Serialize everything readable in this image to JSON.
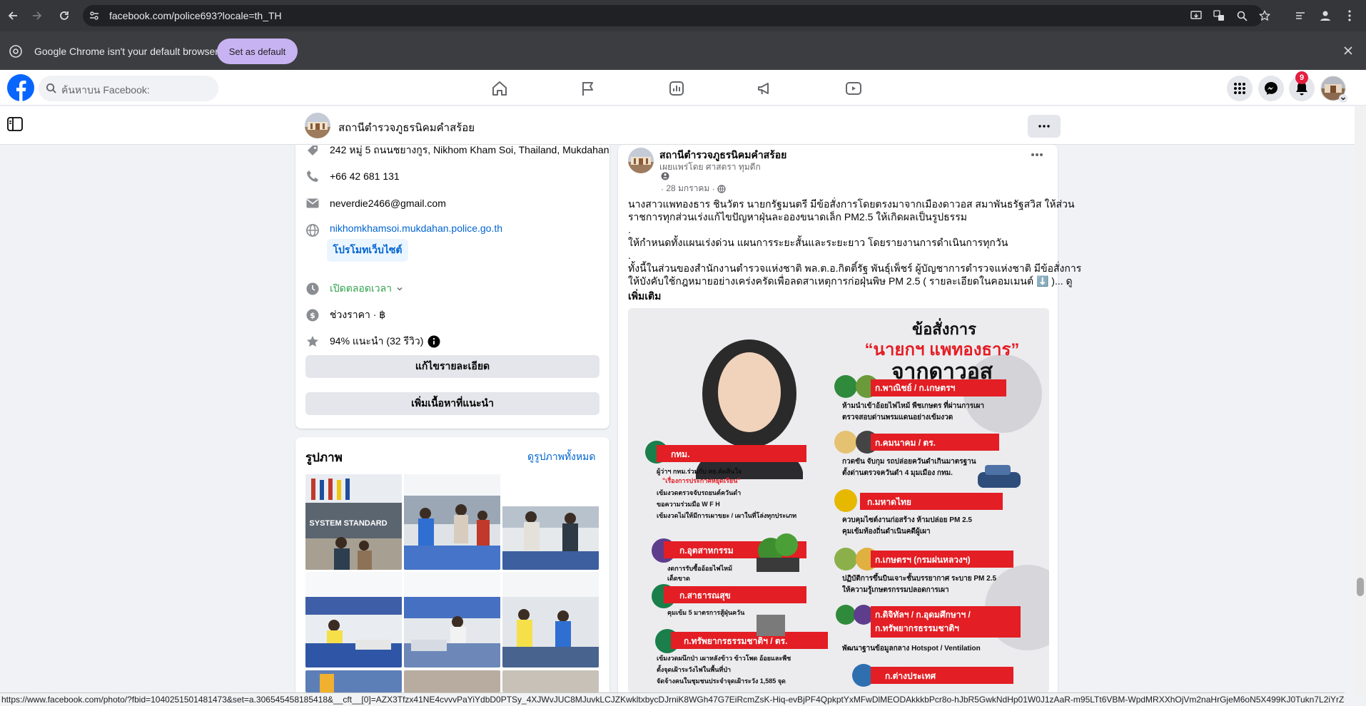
{
  "browser": {
    "url": "facebook.com/police693?locale=th_TH",
    "infobar_text": "Google Chrome isn't your default browser",
    "set_default_label": "Set as default",
    "status_url": "https://www.facebook.com/photo/?fbid=1040251501481473&set=a.306545458185418&__cft__[0]=AZX3Tfzx41NE4cvvvPaYiYdbD0PTSy_4XJWvJUC8MJuvkLCJZKwkltxbycDJrniK8WGh47G7EiRcmZsK-Hiq-evBjPF4QpkptYxMFwDlMEODAkkkbPcr8o-hJbR5GwkNdHp01W0J1zAaR-m95LTt6VBM-WpdMRXXhOjVm2naHrGjeM6oN5X499KJ0Tukn7L2iYrZ09G4hvTSE..."
  },
  "facebook": {
    "search_placeholder": "ค้นหาบน Facebook:",
    "notification_count": "9"
  },
  "page": {
    "name": "สถานีตำรวจภูธรนิคมคำสร้อย"
  },
  "intro": {
    "address": "242 หมู่ 5 ถนนชยางกูร, Nikhom Kham Soi, Thailand, Mukdahan",
    "phone": "+66 42 681 131",
    "email": "neverdie2466@gmail.com",
    "website": "nikhomkhamsoi.mukdahan.police.go.th",
    "promote_label": "โปรโมทเว็บไซต์",
    "hours": "เปิดตลอดเวลา",
    "price": "ช่วงราคา · ฿",
    "rating": "94% แนะนำ (32 รีวิว)",
    "edit_details_label": "แก้ไขรายละเอียด",
    "add_featured_label": "เพิ่มเนื้อหาที่แนะนำ"
  },
  "photos": {
    "title": "รูปภาพ",
    "see_all": "ดูรูปภาพทั้งหมด",
    "sign_text": "SYSTEM STANDARD"
  },
  "post": {
    "author": "สถานีตำรวจภูธรนิคมคำสร้อย",
    "published_by": "เผยแพร่โดย ศาสตรา ทุมดีก",
    "date": "28 มกราคม",
    "lines": [
      "นางสาวแพทองธาร ชินวัตร นายกรัฐมนตรี มีข้อสั่งการโดยตรงมาจากเมืองดาวอส สมาพันธรัฐสวิส ให้ส่วน",
      "ราชการทุกส่วนเร่งแก้ไขปัญหาฝุ่นละอองขนาดเล็ก PM2.5 ให้เกิดผลเป็นรูปธรรม",
      ".",
      "ให้กำหนดทั้งแผนเร่งด่วน แผนการระยะสั้นและระยะยาว โดยรายงานการดำเนินการทุกวัน",
      ".",
      "ทั้งนี้ในส่วนของสำนักงานตำรวจแห่งชาติ พล.ต.อ.กิตติ์รัฐ พันธุ์เพ็ชร์ ผู้บัญชาการตำรวจแห่งชาติ มีข้อสั่งการ",
      "ให้บังคับใช้กฎหมายอย่างเคร่งครัดเพื่อลดสาเหตุการก่อฝุ่นพิษ PM 2.5 ( รายละเอียดในคอมเมนต์ ⬇️ )... ดู"
    ],
    "see_more": "เพิ่มเติม",
    "infographic": {
      "title1": "ข้อสั่งการ",
      "title2": "“นายกฯ แพทองธาร”",
      "title3": "จากดาวอส",
      "sections": [
        {
          "head": "ก.พาณิชย์ / ก.เกษตรฯ",
          "items": [
            "ห้ามนำเข้าอ้อยไฟไหม้ พืชเกษตร ที่ผ่านการเผา",
            "ตรวจสอบด่านพรมแดนอย่างเข้มงวด"
          ]
        },
        {
          "head": "ก.คมนาคม / ตร.",
          "items": [
            "กวดขัน จับกุม รถปล่อยควันดำเกินมาตรฐาน",
            "ตั้งด่านตรวจควันดำ 4 มุมเมือง กทม."
          ]
        },
        {
          "head": "ก.มหาดไทย",
          "items": [
            "ควบคุมไซต์งานก่อสร้าง ห้ามปล่อย PM 2.5",
            "คุมเข้มท้องถิ่นดำเนินคดีผู้เผา"
          ]
        },
        {
          "head": "ก.เกษตรฯ (กรมฝนหลวงฯ)",
          "items": [
            "ปฏิบัติการขึ้นบินเจาะชั้นบรรยากาศ ระบาย PM 2.5",
            "ให้ความรู้เกษตรกรรมปลอดการเผา"
          ]
        },
        {
          "head": "ก.ดิจิทัลฯ / ก.อุดมศึกษาฯ /",
          "items": []
        },
        {
          "head": "ก.ทรัพยากรธรรมชาติฯ",
          "items": [
            "พัฒนาฐานข้อมูลกลาง Hotspot / Ventilation"
          ]
        },
        {
          "head": "ก.ต่างประเทศ",
          "items": []
        }
      ],
      "left_sections": [
        {
          "head": "กทม.",
          "items": [
            "ผู้ว่าฯ กทม.ร่วมกับ ศธ.คัดสินใจ",
            "\"เรื่องการประกาศหยุดเรียน\"",
            "เข้มงวดตรวจจับรถยนต์ควันดำ",
            "ขอความร่วมมือ W F H",
            "เข้มงวดไม่ให้มีการเผาขยะ / เผาในที่โล่งทุกประเภท"
          ]
        },
        {
          "head": "ก.อุตสาหกรรม",
          "items": [
            "งดการรับซื้ออ้อยไฟไหม้",
            "เด็ดขาด"
          ]
        },
        {
          "head": "ก.สาธารณสุข",
          "items": [
            "คุมเข้ม 5 มาตรการสู้ฝุ่นควัน"
          ]
        },
        {
          "head": "ก.ทรัพยากรธรรมชาติฯ / ตร.",
          "items": [
            "เข้มงวดผนึกป่า เผาหลังข้าว ข้าวโพด อ้อยและพืช",
            "ตั้งจุดเฝ้าระวังไฟในพื้นที่ป่า",
            "จัดจ้างคนในชุมชนประจำจุดเฝ้าระวัง 1,585 จุด"
          ]
        }
      ]
    }
  }
}
